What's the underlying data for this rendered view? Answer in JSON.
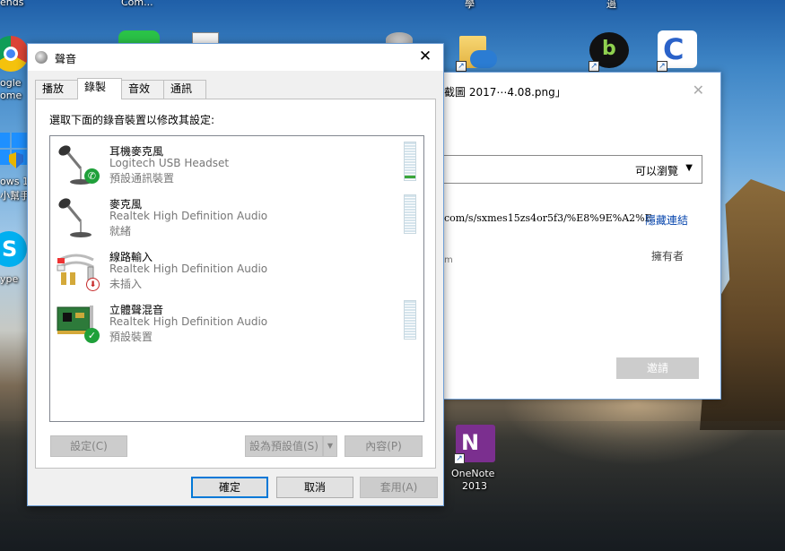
{
  "desktop": {
    "top_labels": [
      "ends",
      "Com...",
      "學",
      "過"
    ],
    "icons": [
      {
        "label_top": "ogle",
        "label_bottom": "ome"
      },
      {
        "label_top": "ows 1",
        "label_bottom": "小幫手"
      },
      {
        "label_top": "ype",
        "label_bottom": ""
      },
      {
        "label_top": "OneNote",
        "label_bottom": "2013"
      }
    ],
    "onenote_glyph": "N"
  },
  "share_dialog": {
    "title": "截圖 2017⋯4.08.png」",
    "close_glyph": "✕",
    "permission_value": "可以瀏覽",
    "link_text": "com/s/sxmes15zs4or5f3/%E8%9E%A2%E",
    "hide_link_label": "隱藏連結",
    "owner_label": "擁有者",
    "partial_text": "m",
    "invite_button": "邀請"
  },
  "sound_dialog": {
    "title": "聲音",
    "close_glyph": "✕",
    "tabs": [
      {
        "label": "播放",
        "active": false
      },
      {
        "label": "錄製",
        "active": true
      },
      {
        "label": "音效",
        "active": false
      },
      {
        "label": "通訊",
        "active": false
      }
    ],
    "instruction": "選取下面的錄音裝置以修改其設定:",
    "devices": [
      {
        "name": "耳機麥克風",
        "description": "Logitech USB Headset",
        "status": "預設通訊裝置",
        "icon": "headset-microphone-icon",
        "badge": "phone",
        "meter_level": 0.05
      },
      {
        "name": "麥克風",
        "description": "Realtek High Definition Audio",
        "status": "就緒",
        "icon": "microphone-icon",
        "badge": "none",
        "meter_level": 0
      },
      {
        "name": "線路輸入",
        "description": "Realtek High Definition Audio",
        "status": "未插入",
        "icon": "line-in-icon",
        "badge": "unplugged",
        "meter_level": null
      },
      {
        "name": "立體聲混音",
        "description": "Realtek High Definition Audio",
        "status": "預設裝置",
        "icon": "sound-card-icon",
        "badge": "check",
        "meter_level": 0
      }
    ],
    "buttons": {
      "configure": "設定(C)",
      "set_default": "設為預設值(S)",
      "properties": "內容(P)",
      "ok": "確定",
      "cancel": "取消",
      "apply": "套用(A)"
    },
    "badge_glyphs": {
      "phone": "✆",
      "unplugged": "⬇",
      "check": "✓"
    }
  },
  "colors": {
    "accent": "#0078d7",
    "meter_green": "#3aa63a",
    "link_blue": "#0645ad"
  }
}
